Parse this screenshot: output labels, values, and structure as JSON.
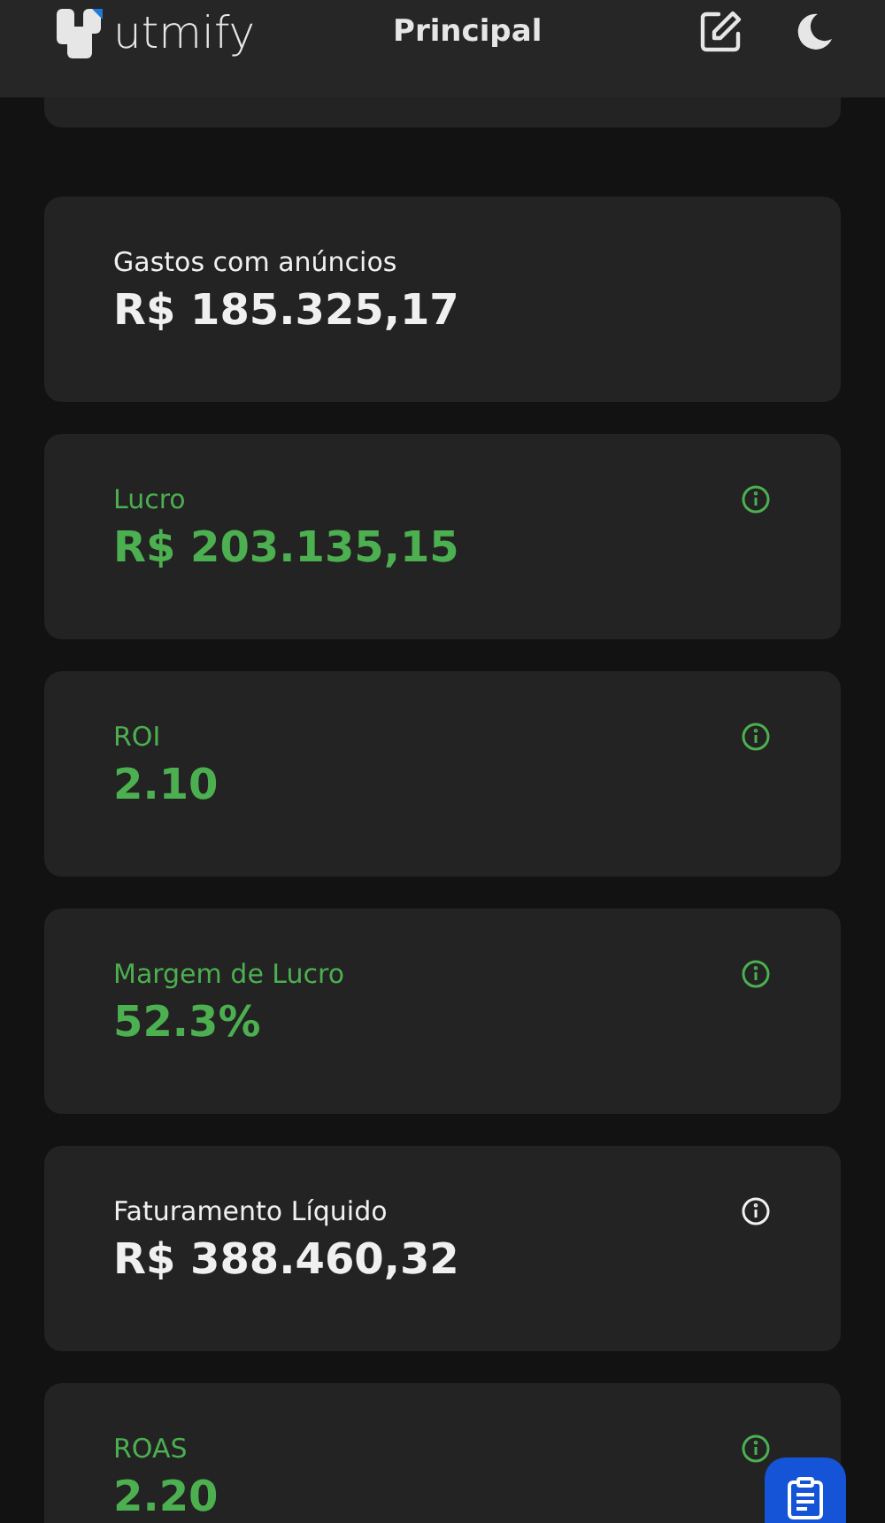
{
  "header": {
    "logo": "utmify",
    "title": "Principal"
  },
  "cards": [
    {
      "label": "Gastos com anúncios",
      "value": "R$ 185.325,17",
      "kind": "neutral",
      "info": false
    },
    {
      "label": "Lucro",
      "value": "R$ 203.135,15",
      "kind": "positive",
      "info": true
    },
    {
      "label": "ROI",
      "value": "2.10",
      "kind": "positive",
      "info": true
    },
    {
      "label": "Margem de Lucro",
      "value": "52.3%",
      "kind": "positive",
      "info": true
    },
    {
      "label": "Faturamento Líquido",
      "value": "R$ 388.460,32",
      "kind": "neutral",
      "info": true
    },
    {
      "label": "ROAS",
      "value": "2.20",
      "kind": "positive",
      "info": true
    }
  ]
}
